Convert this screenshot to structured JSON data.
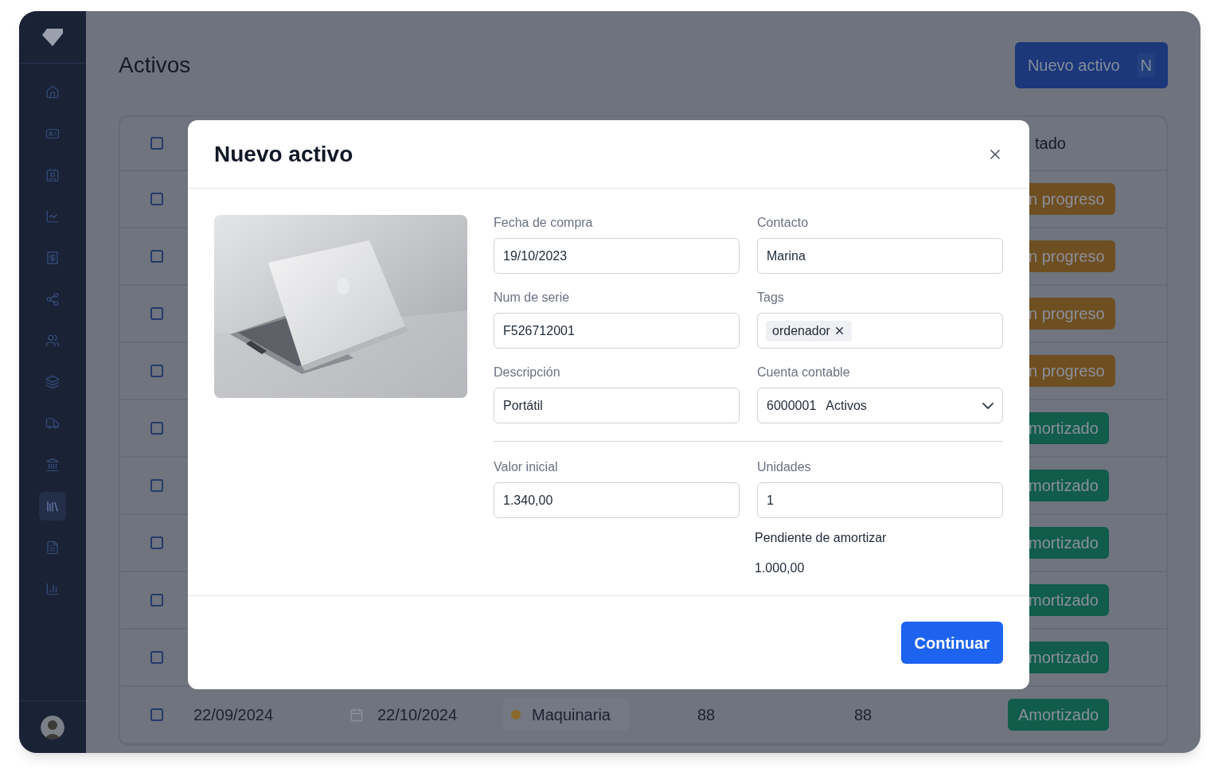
{
  "sidebar": {
    "items": [
      {
        "kind": "home",
        "selected": false
      },
      {
        "kind": "badge",
        "selected": false
      },
      {
        "kind": "contacts",
        "selected": false
      },
      {
        "kind": "chart",
        "selected": false
      },
      {
        "kind": "receipt",
        "selected": false
      },
      {
        "kind": "share",
        "selected": false
      },
      {
        "kind": "users",
        "selected": false
      },
      {
        "kind": "layers",
        "selected": false
      },
      {
        "kind": "truck",
        "selected": false
      },
      {
        "kind": "bank",
        "selected": false
      },
      {
        "kind": "books",
        "selected": true
      },
      {
        "kind": "document",
        "selected": false
      },
      {
        "kind": "bars",
        "selected": false
      }
    ]
  },
  "page": {
    "title": "Activos",
    "new_button": {
      "label": "Nuevo activo",
      "shortcut": "N"
    }
  },
  "table": {
    "header": {
      "status": "tado",
      "checked": false
    },
    "rows": [
      {
        "checked": false,
        "status": {
          "text": "n progreso",
          "kind": "progress"
        }
      },
      {
        "checked": false,
        "status": {
          "text": "n progreso",
          "kind": "progress"
        }
      },
      {
        "checked": false,
        "status": {
          "text": "n progreso",
          "kind": "progress"
        }
      },
      {
        "checked": false,
        "status": {
          "text": "n progreso",
          "kind": "progress"
        }
      },
      {
        "checked": false,
        "status": {
          "text": "mortizado",
          "kind": "done"
        }
      },
      {
        "checked": false,
        "status": {
          "text": "mortizado",
          "kind": "done"
        }
      },
      {
        "checked": false,
        "status": {
          "text": "mortizado",
          "kind": "done"
        }
      },
      {
        "checked": false,
        "status": {
          "text": "mortizado",
          "kind": "done"
        }
      },
      {
        "checked": false,
        "status": {
          "text": "mortizado",
          "kind": "done"
        }
      },
      {
        "checked": false,
        "start": "22/09/2024",
        "end": "22/10/2024",
        "category": {
          "text": "Maquinaria",
          "color": "#8a6a2a"
        },
        "col_5": "88",
        "col_6": "88",
        "status": {
          "text": "Amortizado",
          "kind": "done"
        }
      }
    ]
  },
  "modal": {
    "title": "Nuevo activo",
    "fields": [
      {
        "label": "Fecha de compra",
        "kind": "text",
        "value": "19/10/2023"
      },
      {
        "label": "Contacto",
        "kind": "text",
        "value": "Marina"
      },
      {
        "label": "Num de serie",
        "kind": "text",
        "value": "F526712001"
      },
      {
        "label": "Tags",
        "kind": "tags",
        "tags": [
          "ordenador"
        ]
      },
      {
        "label": "Descripción",
        "kind": "text",
        "value": "Portátil"
      },
      {
        "label": "Cuenta contable",
        "kind": "select",
        "value": "6000001",
        "value_2": "Activos"
      }
    ],
    "fields_2": [
      {
        "label": "Valor inicial",
        "kind": "text",
        "value": "1.340,00"
      },
      {
        "label": "Unidades",
        "kind": "text",
        "value": "1"
      }
    ],
    "pending": {
      "label": "Pendiente de amortizar",
      "value": "1.000,00"
    },
    "continue_button": "Continuar"
  }
}
